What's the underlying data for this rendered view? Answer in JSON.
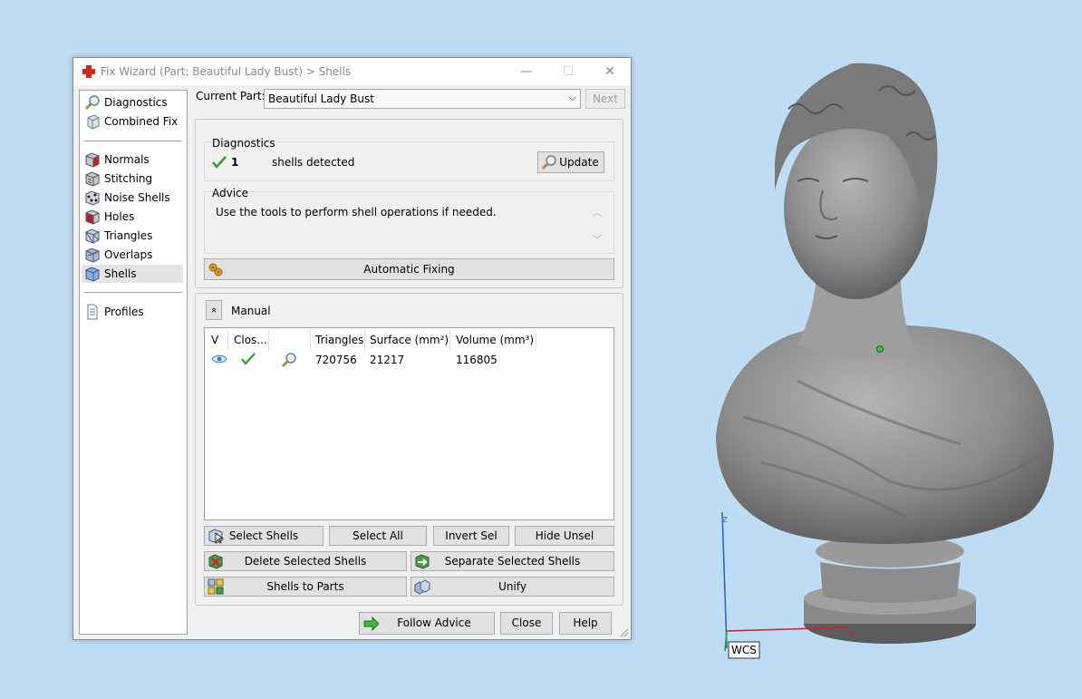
{
  "window": {
    "title": "Fix Wizard (Part: Beautiful Lady Bust) > Shells",
    "minimize": "—",
    "maximize": "☐",
    "close": "✕"
  },
  "sidebar": {
    "group1": [
      {
        "label": "Diagnostics",
        "icon": "magnifier-icon"
      },
      {
        "label": "Combined Fix",
        "icon": "cube-icon"
      }
    ],
    "group2": [
      {
        "label": "Normals",
        "icon": "normals-cube-icon"
      },
      {
        "label": "Stitching",
        "icon": "stitching-cube-icon"
      },
      {
        "label": "Noise Shells",
        "icon": "noise-shells-icon"
      },
      {
        "label": "Holes",
        "icon": "holes-cube-icon"
      },
      {
        "label": "Triangles",
        "icon": "triangles-cube-icon"
      },
      {
        "label": "Overlaps",
        "icon": "overlaps-cube-icon"
      },
      {
        "label": "Shells",
        "icon": "shells-cube-icon",
        "selected": true
      }
    ],
    "group3": [
      {
        "label": "Profiles",
        "icon": "document-icon"
      }
    ]
  },
  "current_part": {
    "label": "Current Part:",
    "value": "Beautiful Lady Bust",
    "next_label": "Next"
  },
  "diagnostics": {
    "title": "Diagnostics",
    "count": "1",
    "text": "shells detected",
    "update_label": "Update"
  },
  "advice": {
    "title": "Advice",
    "text": "Use the tools to perform shell operations if needed."
  },
  "automatic_fixing_label": "Automatic Fixing",
  "manual": {
    "label": "Manual",
    "collapse": "«"
  },
  "table": {
    "headers": [
      "V",
      "Clos...",
      "",
      "Triangles",
      "Surface (mm²)",
      "Volume (mm³)"
    ],
    "rows": [
      {
        "triangles": "720756",
        "surface": "21217",
        "volume": "116805"
      }
    ]
  },
  "tools": {
    "select_shells": "Select Shells",
    "select_all": "Select All",
    "invert_sel": "Invert Sel",
    "hide_unsel": "Hide Unsel",
    "delete_selected_shells": "Delete Selected Shells",
    "separate_selected_shells": "Separate Selected Shells",
    "shells_to_parts": "Shells to Parts",
    "unify": "Unify"
  },
  "footer": {
    "follow_advice": "Follow Advice",
    "close": "Close",
    "help": "Help"
  },
  "viewport": {
    "axis_z": "z",
    "axis_x": "x",
    "wcs": "WCS"
  },
  "colors": {
    "background": "#bfdcf5",
    "axis_z": "#2a5fd0",
    "axis_x": "#d02020",
    "axis_y": "#20a020",
    "check_green": "#2e9b2e"
  }
}
